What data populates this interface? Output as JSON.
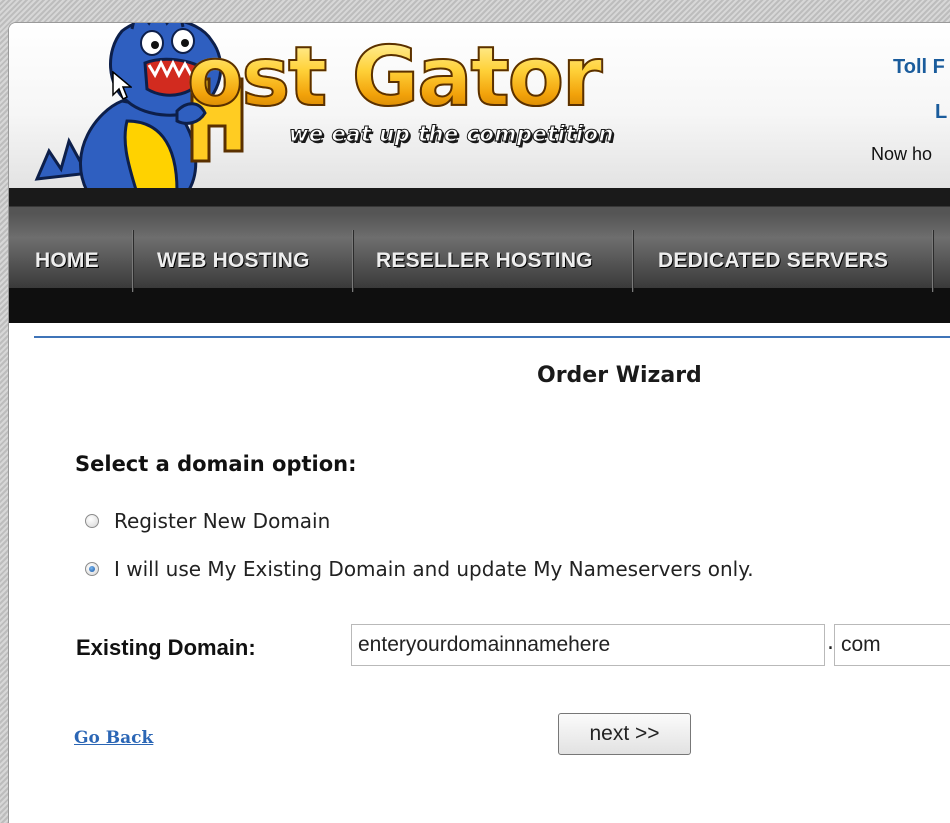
{
  "header": {
    "logo_text": "Host Gator",
    "logo_letters": "ost Gator",
    "tagline": "we eat up the competition",
    "toll": "Toll F",
    "live": "L",
    "now_hosting": "Now ho"
  },
  "nav": {
    "items": [
      {
        "label": "HOME"
      },
      {
        "label": "WEB HOSTING"
      },
      {
        "label": "RESELLER HOSTING"
      },
      {
        "label": "DEDICATED SERVERS"
      }
    ]
  },
  "wizard": {
    "title": "Order Wizard",
    "section_title": "Select a domain option:",
    "options": [
      {
        "label": "Register New Domain",
        "checked": false
      },
      {
        "label": "I will use My Existing Domain and update My Nameservers only.",
        "checked": true
      }
    ],
    "existing_domain_label": "Existing Domain:",
    "domain_value": "enteryourdomainnamehere",
    "tld_value": "com",
    "separator": ".",
    "go_back": "Go Back",
    "next": "next >>"
  },
  "colors": {
    "brand_blue": "#1a5c9c",
    "link": "#2b66b5",
    "divider": "#3f74b8",
    "gator_blue": "#2f5fc0",
    "gator_yellow": "#ffd200"
  },
  "icons": {
    "mascot": "gator-mascot-icon",
    "cursor": "mouse-pointer-icon"
  }
}
